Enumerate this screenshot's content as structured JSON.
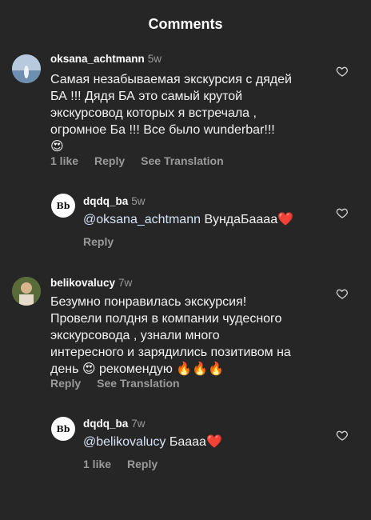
{
  "header": {
    "title": "Comments"
  },
  "comments": [
    {
      "username": "oksana_achtmann",
      "time": "5w",
      "text": "Самая незабываемая экскурсия  с дядей\nБА !!! Дядя БА это самый крутой\nэкскурсовод которых я встречала ,\nогромное  Ба !!! Все было wunderbar!!!\n😍",
      "likes": "1 like",
      "reply": "Reply",
      "translate": "See Translation"
    },
    {
      "username": "dqdq_ba",
      "time": "5w",
      "mention": "@oksana_achtmann",
      "text": " ВундаБаааа❤️",
      "reply": "Reply"
    },
    {
      "username": "belikovalucy",
      "time": "7w",
      "text": "Безумно понравилась экскурсия!\nПровели полдня в компании чудесного\nэкскурсовода , узнали много\nинтересного и зарядились позитивом на\nдень 😍 рекомендую 🔥🔥🔥",
      "reply": "Reply",
      "translate": "See Translation"
    },
    {
      "username": "dqdq_ba",
      "time": "7w",
      "mention": "@belikovalucy",
      "text": " Баааа❤️",
      "likes": "1 like",
      "reply": "Reply"
    }
  ],
  "logo_text": "Bb",
  "icons": {
    "like": "heart-outline-icon"
  }
}
